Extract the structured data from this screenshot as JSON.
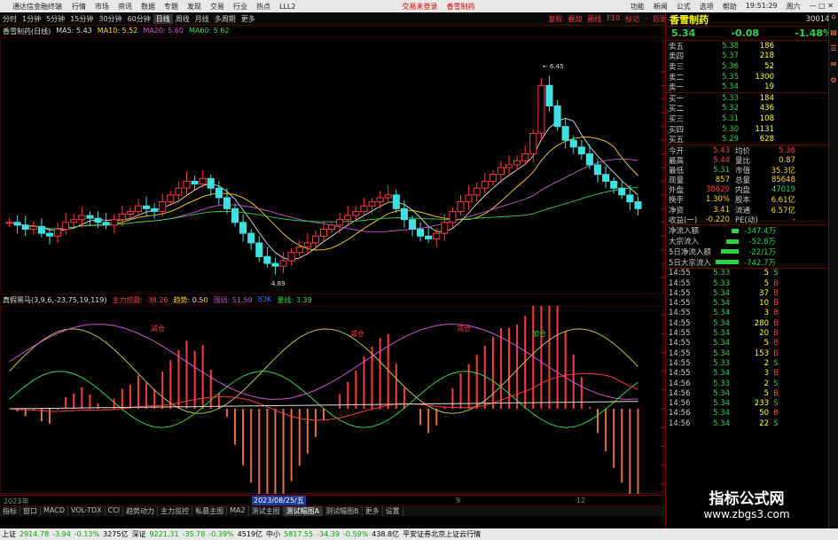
{
  "menu": {
    "app_title": "通达信金融终端",
    "items": [
      "行情",
      "市场",
      "资讯",
      "数据",
      "专题",
      "发现",
      "交易",
      "行业",
      "热点",
      "LLL2"
    ],
    "trade_links": [
      "交易未登录",
      "香雪制药"
    ],
    "right_items": [
      "功能",
      "新闻",
      "公式",
      "选项",
      "帮助",
      "19:51:29",
      "周六"
    ]
  },
  "toolbar": {
    "periods": [
      "分时",
      "1分钟",
      "5分钟",
      "15分钟",
      "30分钟",
      "60分钟",
      "日线",
      "周线",
      "月线",
      "多周期",
      "更多"
    ],
    "selected": "日线",
    "right_items": [
      "复权",
      "叠加",
      "画线",
      "F10",
      "标记",
      "-",
      "后退",
      "返回"
    ]
  },
  "main_info": {
    "name": "香雪制药(日线)",
    "ma5": "MA5: 5.43",
    "ma10": "MA10: 5.52",
    "ma20": "MA20: 5.60",
    "ma60": "MA60: 5.62"
  },
  "sub_info": {
    "name": "真假黑马(3,9,6,-23,75,19,119)",
    "items": [
      {
        "label": "主力控盘: -38.26",
        "color": "#ff3b3b"
      },
      {
        "label": "趋势: 0.50",
        "color": "#ffd700"
      },
      {
        "label": "强弱: 51.59",
        "color": "#c050c0"
      },
      {
        "label": "B3K",
        "color": "#3a6bff"
      },
      {
        "label": "量线: 3.39",
        "color": "#2dd24b"
      }
    ]
  },
  "chart_data": {
    "type": "candlestick",
    "ylim": [
      4.8,
      6.6
    ],
    "price_ticks": [
      "6.40",
      "6.30",
      "6.20",
      "6.10",
      "6.00",
      "5.90",
      "5.80",
      "5.70",
      "5.60",
      "5.50",
      "5.40",
      "5.30",
      "5.20",
      "5.10",
      "5.00",
      "4.90"
    ],
    "high_label": "6.45",
    "low_label": "4.89",
    "price_marker": "5.51",
    "sub_ticks": [
      "100.0",
      "80.00",
      "60.00",
      "40.00",
      "20.00",
      "0.00",
      "-20.00",
      "-40.00",
      "-60.00",
      "-80.00"
    ],
    "signals": [
      "减仓",
      "减仓",
      "减仓",
      "加仓"
    ],
    "date_labels": [
      "2023年",
      "2023/08/25/五",
      "9",
      "12"
    ],
    "closes": [
      5.3,
      5.28,
      5.25,
      5.27,
      5.22,
      5.2,
      5.25,
      5.3,
      5.32,
      5.35,
      5.33,
      5.3,
      5.28,
      5.32,
      5.36,
      5.38,
      5.42,
      5.4,
      5.38,
      5.45,
      5.5,
      5.55,
      5.6,
      5.58,
      5.62,
      5.55,
      5.48,
      5.4,
      5.3,
      5.22,
      5.15,
      5.05,
      5.0,
      4.98,
      5.02,
      5.08,
      5.12,
      5.15,
      5.2,
      5.25,
      5.28,
      5.32,
      5.35,
      5.38,
      5.42,
      5.45,
      5.48,
      5.5,
      5.4,
      5.32,
      5.25,
      5.2,
      5.18,
      5.22,
      5.3,
      5.38,
      5.45,
      5.5,
      5.55,
      5.6,
      5.65,
      5.7,
      5.72,
      5.75,
      5.8,
      5.95,
      6.3,
      6.15,
      6.0,
      5.9,
      5.85,
      5.8,
      5.72,
      5.65,
      5.6,
      5.55,
      5.5,
      5.45,
      5.4
    ]
  },
  "quote": {
    "name": "香雪制药",
    "code": "300147",
    "price": "5.34",
    "change": "-0.08",
    "pct": "-1.48%",
    "asks": [
      {
        "label": "卖五",
        "price": "5.38",
        "vol": "186"
      },
      {
        "label": "卖四",
        "price": "5.37",
        "vol": "218"
      },
      {
        "label": "卖三",
        "price": "5.36",
        "vol": "52"
      },
      {
        "label": "卖二",
        "price": "5.35",
        "vol": "1300"
      },
      {
        "label": "卖一",
        "price": "5.34",
        "vol": "19"
      }
    ],
    "bids": [
      {
        "label": "买一",
        "price": "5.33",
        "vol": "184"
      },
      {
        "label": "买二",
        "price": "5.32",
        "vol": "436"
      },
      {
        "label": "买三",
        "price": "5.31",
        "vol": "108"
      },
      {
        "label": "买四",
        "price": "5.30",
        "vol": "1131"
      },
      {
        "label": "买五",
        "price": "5.29",
        "vol": "628"
      }
    ],
    "stats": [
      {
        "k": "今开",
        "v": "5.43",
        "c": "r",
        "k2": "均价",
        "v2": "5.36",
        "c2": "r"
      },
      {
        "k": "最高",
        "v": "5.44",
        "c": "r",
        "k2": "量比",
        "v2": "0.87",
        "c2": "y"
      },
      {
        "k": "最低",
        "v": "5.31",
        "c": "g",
        "k2": "市值",
        "v2": "35.3亿",
        "c2": "y"
      },
      {
        "k": "现量",
        "v": "857",
        "c": "y",
        "k2": "总量",
        "v2": "85648",
        "c2": "y"
      },
      {
        "k": "外盘",
        "v": "38629",
        "c": "r",
        "k2": "内盘",
        "v2": "47019",
        "c2": "g"
      },
      {
        "k": "换手",
        "v": "1.30%",
        "c": "y",
        "k2": "股本",
        "v2": "6.61亿",
        "c2": "y"
      },
      {
        "k": "净资",
        "v": "3.41",
        "c": "y",
        "k2": "流通",
        "v2": "6.57亿",
        "c2": "y"
      },
      {
        "k": "收益(一)",
        "v": "-0.220",
        "c": "y",
        "k2": "PE(动)",
        "v2": "-",
        "c2": "y"
      }
    ],
    "flows": [
      {
        "k": "净流入额",
        "v": "-347.4万",
        "c": "g"
      },
      {
        "k": "大宗流入",
        "v": "-52.8万",
        "c": "g"
      },
      {
        "k": "5日净流入额",
        "v": "-22/1万",
        "c": "g"
      },
      {
        "k": "5日大宗流入",
        "v": "-742.7万",
        "c": "g"
      }
    ],
    "ticks": [
      {
        "t": "14:55",
        "p": "5.33",
        "q": "5",
        "s": "S"
      },
      {
        "t": "14:55",
        "p": "5.33",
        "q": "5",
        "s": "B"
      },
      {
        "t": "14:55",
        "p": "5.34",
        "q": "37",
        "s": "B"
      },
      {
        "t": "14:55",
        "p": "5.34",
        "q": "10",
        "s": "B"
      },
      {
        "t": "14:55",
        "p": "5.34",
        "q": "3",
        "s": "B"
      },
      {
        "t": "14:55",
        "p": "5.34",
        "q": "280",
        "s": "B"
      },
      {
        "t": "14:55",
        "p": "5.34",
        "q": "20",
        "s": "B"
      },
      {
        "t": "14:55",
        "p": "5.34",
        "q": "5",
        "s": "B"
      },
      {
        "t": "14:55",
        "p": "5.34",
        "q": "153",
        "s": "B"
      },
      {
        "t": "14:55",
        "p": "5.33",
        "q": "2",
        "s": "S"
      },
      {
        "t": "14:55",
        "p": "5.34",
        "q": "3",
        "s": "B"
      },
      {
        "t": "14:56",
        "p": "5.33",
        "q": "2",
        "s": "S"
      },
      {
        "t": "14:56",
        "p": "5.34",
        "q": "5",
        "s": "B"
      },
      {
        "t": "14:56",
        "p": "5.34",
        "q": "233",
        "s": "S"
      },
      {
        "t": "14:56",
        "p": "5.34",
        "q": "50",
        "s": "B"
      },
      {
        "t": "14:56",
        "p": "5.34",
        "q": "22",
        "s": "S"
      }
    ]
  },
  "tabs": [
    "指标",
    "窗口",
    "MACD",
    "VOL-TDX",
    "CCI",
    "趋势动力",
    "主力监控",
    "私募主图",
    "MA2",
    "测试主图",
    "测试幅图A",
    "测试幅图B",
    "更多",
    "设置"
  ],
  "tabs_active": "测试幅图A",
  "status": [
    {
      "t": "上证",
      "c": "#000"
    },
    {
      "t": "2914.78",
      "c": "#0a0"
    },
    {
      "t": "-3.94",
      "c": "#0a0"
    },
    {
      "t": "-0.13%",
      "c": "#0a0"
    },
    {
      "t": "3275亿",
      "c": "#000"
    },
    {
      "t": "深证",
      "c": "#000"
    },
    {
      "t": "9221.31",
      "c": "#0a0"
    },
    {
      "t": "-35.78",
      "c": "#0a0"
    },
    {
      "t": "-0.39%",
      "c": "#0a0"
    },
    {
      "t": "4519亿",
      "c": "#000"
    },
    {
      "t": "中小",
      "c": "#000"
    },
    {
      "t": "5817.55",
      "c": "#0a0"
    },
    {
      "t": "-34.39",
      "c": "#0a0"
    },
    {
      "t": "-0.59%",
      "c": "#0a0"
    },
    {
      "t": "438.8亿",
      "c": "#000"
    },
    {
      "t": "平安证券北京上证云行情",
      "c": "#000"
    }
  ],
  "watermark": {
    "line1": "指标公式网",
    "line2": "www.zbgs3.com"
  },
  "sidebar_icons": [
    "home-icon",
    "chart-icon",
    "list-icon",
    "bell-icon",
    "gear-icon"
  ]
}
